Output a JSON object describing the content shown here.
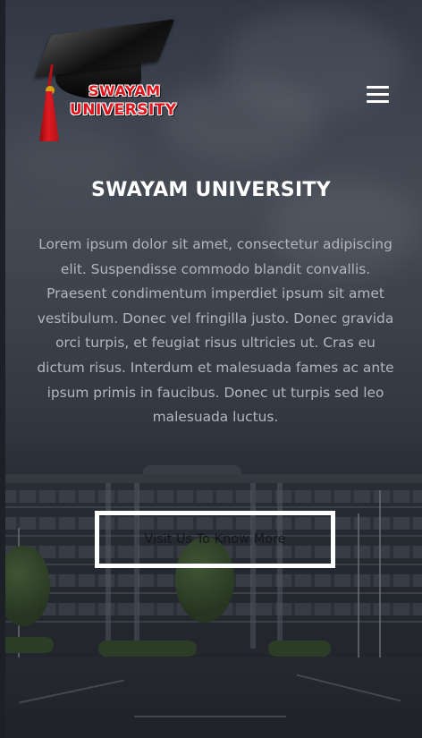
{
  "brand": {
    "logo_line1": "SWAYAM",
    "logo_line2": "UNIVERSITY"
  },
  "hero": {
    "title": "SWAYAM UNIVERSITY",
    "description": "Lorem ipsum dolor sit amet, consectetur adipiscing elit. Suspendisse commodo blandit convallis. Praesent condimentum imperdiet ipsum sit amet vestibulum. Donec vel fringilla justo. Donec gravida orci turpis, et feugiat risus ultricies ut. Cras eu dictum risus. Interdum et malesuada fames ac ante ipsum primis in faucibus. Donec ut turpis sed leo malesuada luctus.",
    "cta_label": "Visit Us To Know More"
  },
  "icons": {
    "menu": "hamburger-menu-icon",
    "logo": "graduation-cap-icon"
  },
  "colors": {
    "logo_red": "#e3141c",
    "title": "#ffffff",
    "body_text": "#b4b6bb",
    "cta_border": "#ffffff"
  }
}
